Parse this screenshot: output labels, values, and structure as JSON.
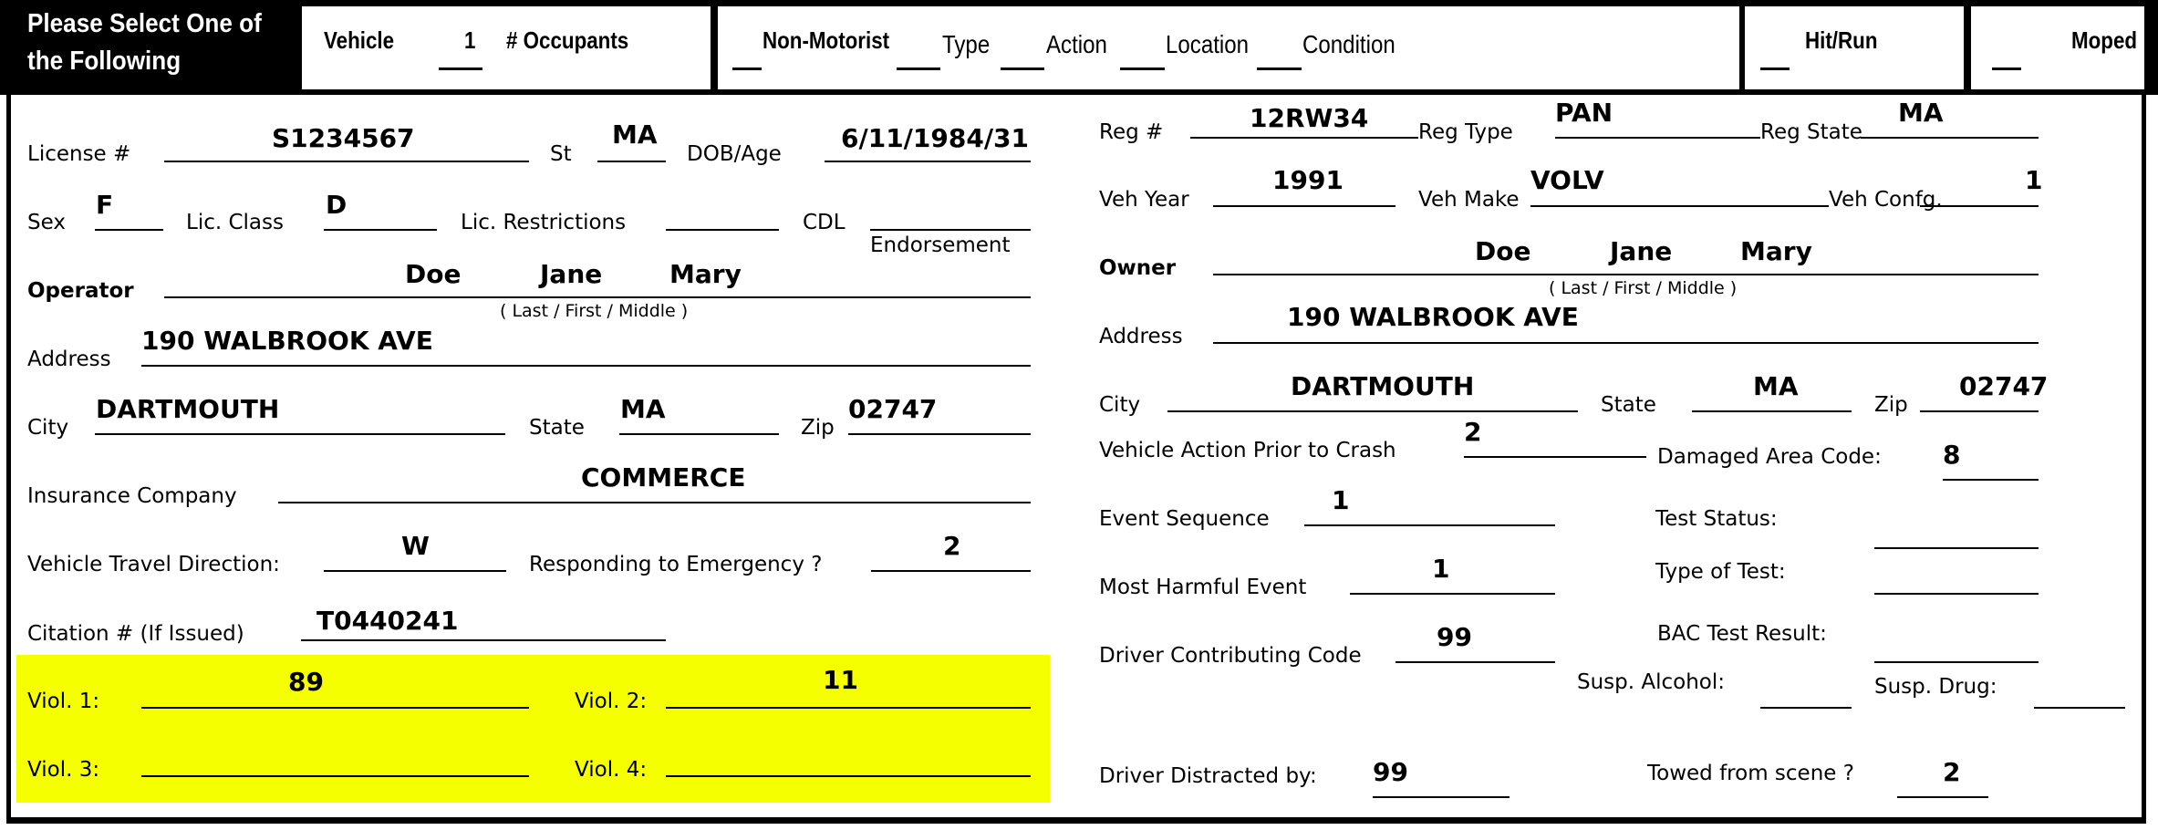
{
  "header": {
    "select_prompt": "Please Select One of the Following",
    "vehicle_label": "Vehicle",
    "vehicle_value": "1",
    "occupants_label": "# Occupants",
    "non_motorist_label": "Non-Motorist",
    "type_label": "Type",
    "action_label": "Action",
    "location_label": "Location",
    "condition_label": "Condition",
    "hit_run_label": "Hit/Run",
    "moped_label": "Moped"
  },
  "operator": {
    "license_label": "License #",
    "license_value": "S1234567",
    "st_label": "St",
    "st_value": "MA",
    "dob_label": "DOB/Age",
    "dob_value": "6/11/1984/31",
    "sex_label": "Sex",
    "sex_value": "F",
    "lic_class_label": "Lic. Class",
    "lic_class_value": "D",
    "lic_restrictions_label": "Lic. Restrictions",
    "lic_restrictions_value": "",
    "cdl_label": "CDL",
    "cdl_value": "",
    "endorsement_label": "Endorsement",
    "operator_label": "Operator",
    "last_name": "Doe",
    "first_name": "Jane",
    "middle_name": "Mary",
    "name_hint": "( Last / First /  Middle )",
    "address_label": "Address",
    "address_value": "190 WALBROOK AVE",
    "city_label": "City",
    "city_value": "DARTMOUTH",
    "state_label": "State",
    "state_value": "MA",
    "zip_label": "Zip",
    "zip_value": "02747",
    "insurance_label": "Insurance Company",
    "insurance_value": "COMMERCE",
    "travel_dir_label": "Vehicle Travel Direction:",
    "travel_dir_value": "W",
    "responding_label": "Responding to Emergency ?",
    "responding_value": "2",
    "citation_label": "Citation # (If Issued)",
    "citation_value": "T0440241"
  },
  "violations": {
    "accent_color": "#f5ff00",
    "items": [
      {
        "label": "Viol. 1:",
        "value": "89"
      },
      {
        "label": "Viol. 2:",
        "value": "11"
      },
      {
        "label": "Viol. 3:",
        "value": ""
      },
      {
        "label": "Viol. 4:",
        "value": ""
      }
    ]
  },
  "vehicle": {
    "reg_label": "Reg #",
    "reg_value": "12RW34",
    "reg_type_label": "Reg Type",
    "reg_type_value": "PAN",
    "reg_state_label": "Reg State",
    "reg_state_value": "MA",
    "veh_year_label": "Veh Year",
    "veh_year_value": "1991",
    "veh_make_label": "Veh Make",
    "veh_make_value": "VOLV",
    "veh_config_label": "Veh Confg.",
    "veh_config_value": "1",
    "owner_label": "Owner",
    "owner_last": "Doe",
    "owner_first": "Jane",
    "owner_middle": "Mary",
    "name_hint": "( Last / First /  Middle )",
    "address_label": "Address",
    "address_value": "190 WALBROOK AVE",
    "city_label": "City",
    "city_value": "DARTMOUTH",
    "state_label": "State",
    "state_value": "MA",
    "zip_label": "Zip",
    "zip_value": "02747",
    "action_prior_label": "Vehicle Action Prior to Crash",
    "action_prior_value": "2",
    "damaged_area_label": "Damaged Area Code:",
    "damaged_area_value": "8",
    "event_seq_label": "Event Sequence",
    "event_seq_value": "1",
    "test_status_label": "Test Status:",
    "test_status_value": "",
    "most_harmful_label": "Most Harmful Event",
    "most_harmful_value": "1",
    "type_of_test_label": "Type of Test:",
    "type_of_test_value": "",
    "driver_contrib_label": "Driver Contributing Code",
    "driver_contrib_value": "99",
    "bac_label": "BAC Test Result:",
    "bac_value": "",
    "susp_alcohol_label": "Susp. Alcohol:",
    "susp_alcohol_value": "",
    "susp_drug_label": "Susp. Drug:",
    "susp_drug_value": "",
    "distracted_label": "Driver Distracted by:",
    "distracted_value": "99",
    "towed_label": "Towed from scene ?",
    "towed_value": "2"
  }
}
